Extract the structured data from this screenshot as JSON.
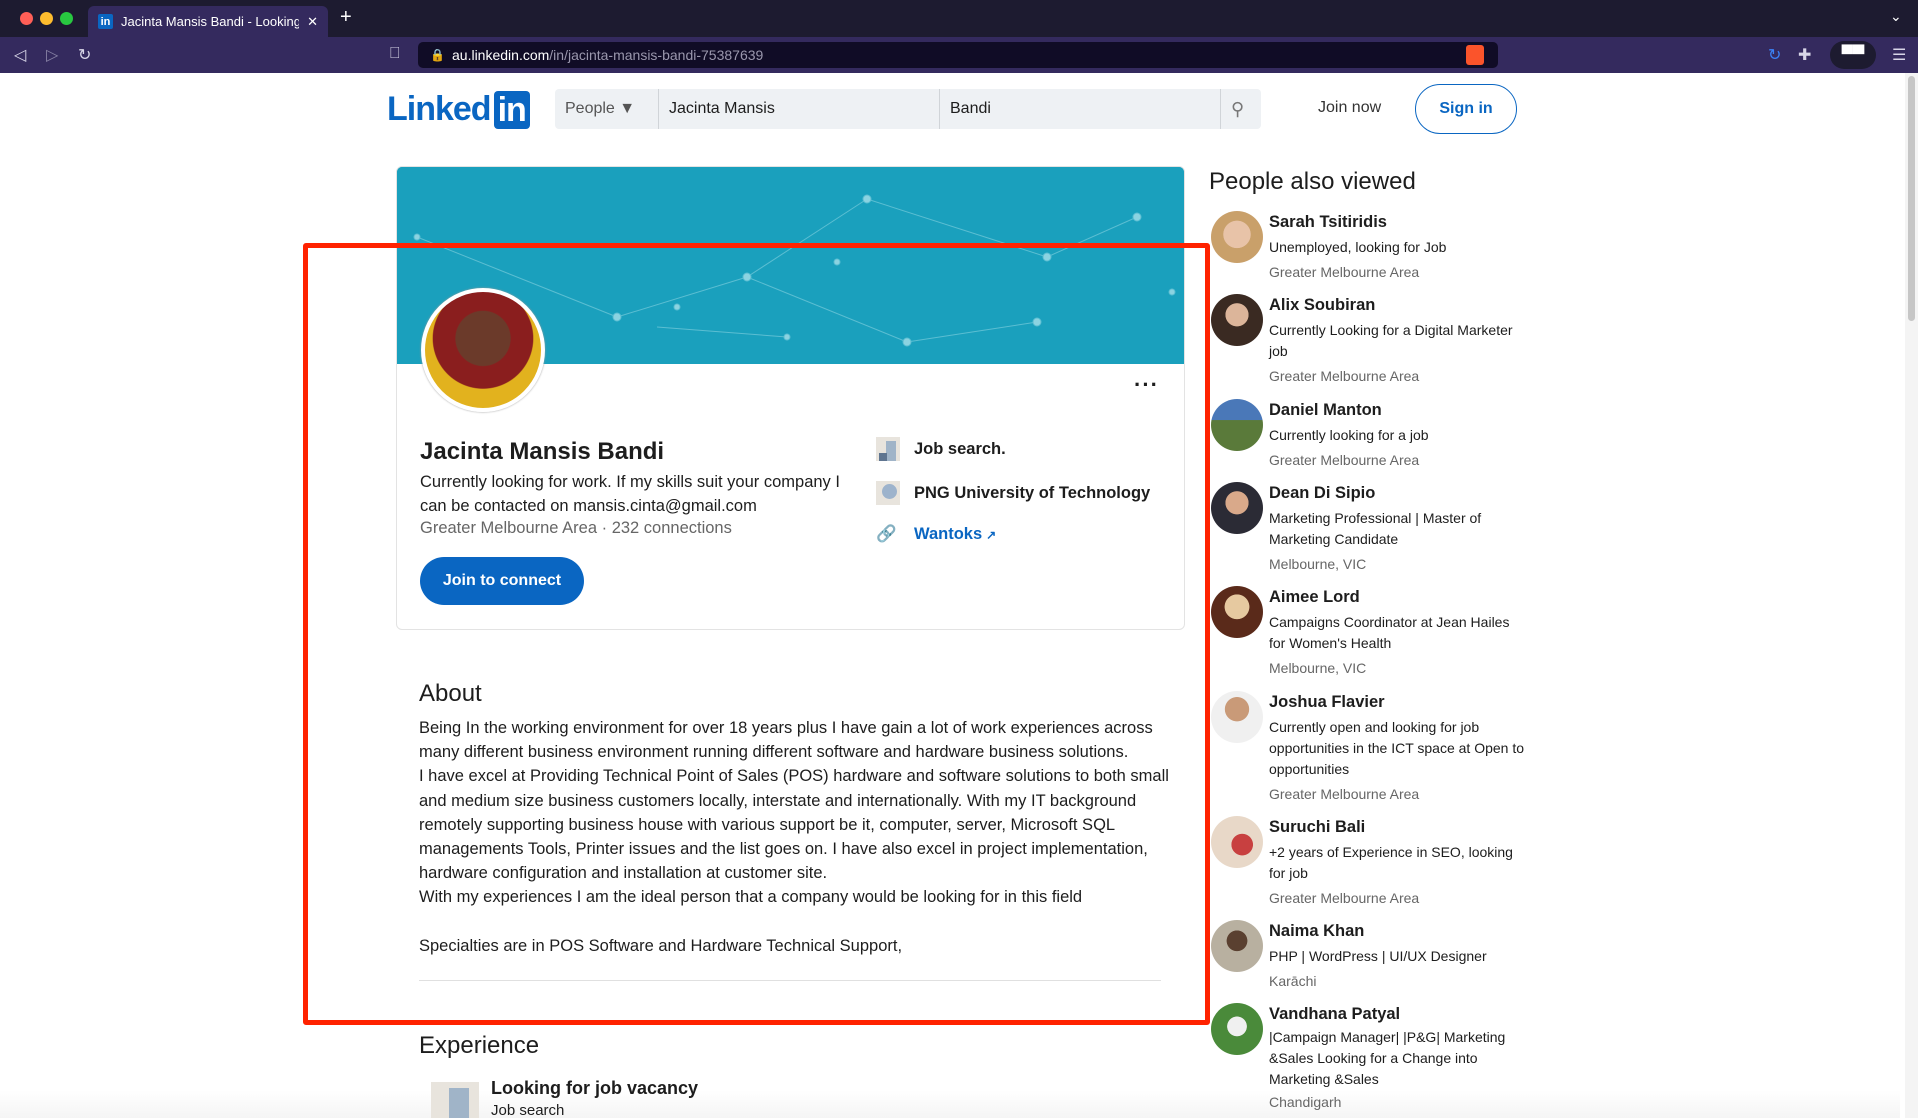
{
  "browser": {
    "tab_title": "Jacinta Mansis Bandi - Looking",
    "url_host": "au.linkedin.com",
    "url_path": "/in/jacinta-mansis-bandi-75387639"
  },
  "header": {
    "logo": "Linkedin",
    "search_category": "People",
    "first_name": "Jacinta  Mansis",
    "last_name": "Bandi",
    "join_now": "Join now",
    "sign_in": "Sign in"
  },
  "profile": {
    "name": "Jacinta Mansis Bandi",
    "headline": "Currently looking for work. If my skills suit your company I can be contacted on mansis.cinta@gmail.com",
    "location": "Greater Melbourne Area",
    "connections": "232 connections",
    "join_button": "Join to connect",
    "company": "Job search.",
    "school": "PNG University of Technology",
    "website": "Wantoks"
  },
  "about": {
    "heading": "About",
    "text": "Being In the working environment for over 18 years plus I have gain a lot of work experiences across many different business environment running different software and hardware business solutions.\nI have excel at Providing Technical Point of Sales (POS) hardware and software solutions to both small and medium size business customers locally, interstate and internationally. With my IT background remotely supporting business house with various support be it, computer, server, Microsoft SQL managements Tools, Printer issues and the list goes on. I have also excel in project implementation, hardware configuration and installation at customer site.\nWith my experiences I am the ideal person that a company would be looking for in this field\n\nSpecialties are in POS Software and Hardware Technical Support,"
  },
  "experience": {
    "heading": "Experience",
    "title": "Looking for job vacancy",
    "company": "Job search"
  },
  "sidebar": {
    "heading": "People also viewed",
    "people": [
      {
        "name": "Sarah Tsitiridis",
        "headline": "Unemployed, looking for Job",
        "location": "Greater Melbourne Area"
      },
      {
        "name": "Alix Soubiran",
        "headline": "Currently Looking for a Digital Marketer job",
        "location": "Greater Melbourne Area"
      },
      {
        "name": "Daniel Manton",
        "headline": "Currently looking for a job",
        "location": "Greater Melbourne Area"
      },
      {
        "name": "Dean Di Sipio",
        "headline": "Marketing Professional | Master of Marketing Candidate",
        "location": "Melbourne, VIC"
      },
      {
        "name": "Aimee Lord",
        "headline": "Campaigns Coordinator at Jean Hailes for Women's Health",
        "location": "Melbourne, VIC"
      },
      {
        "name": "Joshua Flavier",
        "headline": "Currently open and looking for job opportunities in the ICT space at Open to opportunities",
        "location": "Greater Melbourne Area"
      },
      {
        "name": "Suruchi Bali",
        "headline": "+2 years of Experience in SEO, looking for job",
        "location": "Greater Melbourne Area"
      },
      {
        "name": "Naima Khan",
        "headline": "PHP | WordPress | UI/UX Designer",
        "location": "Karāchi"
      },
      {
        "name": "Vandhana Patyal",
        "headline": "|Campaign Manager| |P&G| Marketing &Sales Looking for a Change into Marketing &Sales",
        "location": "Chandigarh"
      }
    ]
  },
  "colors": {
    "brand": "#0a66c2",
    "highlight": "#ff2200",
    "banner": "#1aa0bd"
  }
}
